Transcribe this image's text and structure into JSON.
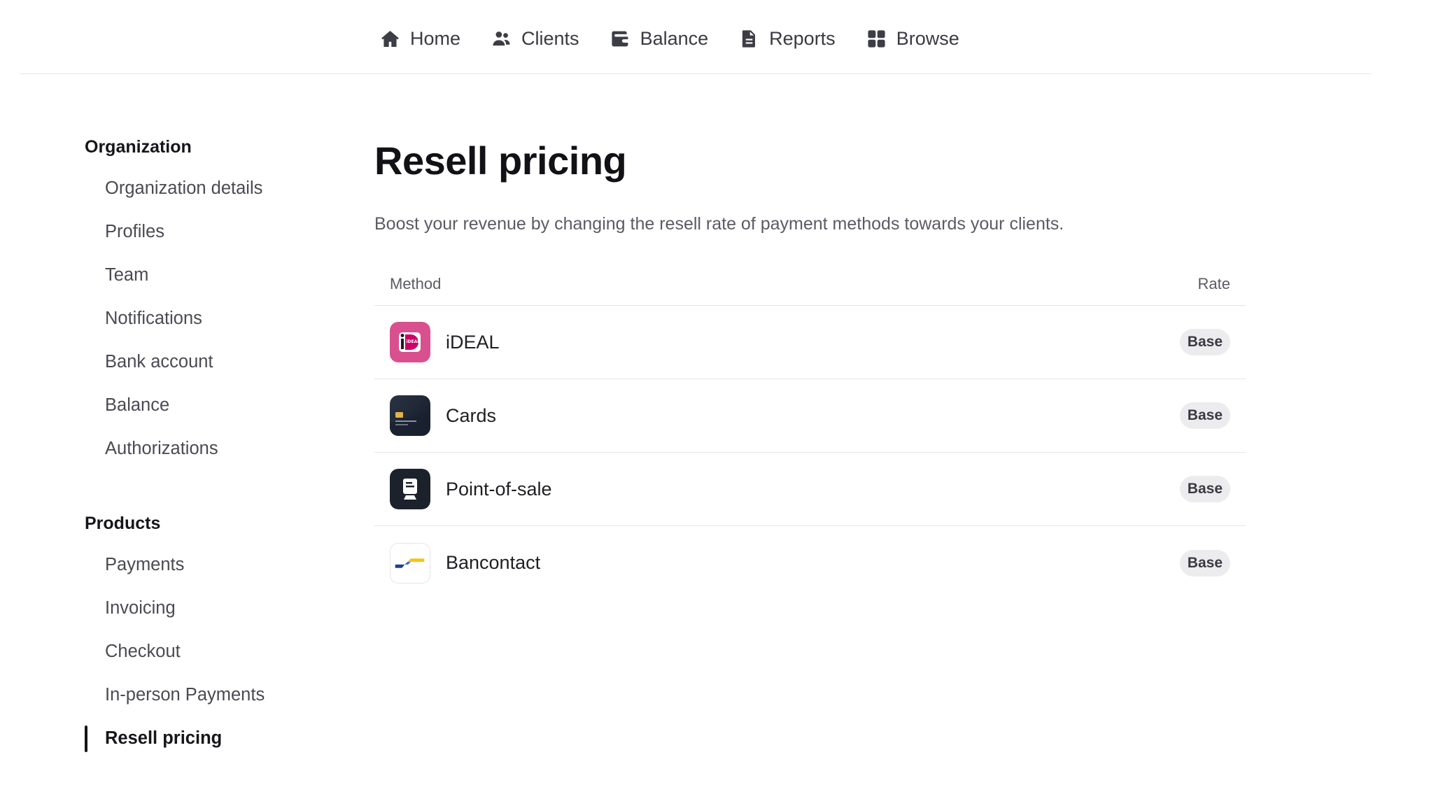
{
  "nav": {
    "items": [
      {
        "label": "Home",
        "icon": "home-icon"
      },
      {
        "label": "Clients",
        "icon": "users-icon"
      },
      {
        "label": "Balance",
        "icon": "wallet-icon"
      },
      {
        "label": "Reports",
        "icon": "document-icon"
      },
      {
        "label": "Browse",
        "icon": "grid-icon"
      }
    ]
  },
  "sidebar": {
    "organization": {
      "heading": "Organization",
      "items": [
        "Organization details",
        "Profiles",
        "Team",
        "Notifications",
        "Bank account",
        "Balance",
        "Authorizations"
      ]
    },
    "products": {
      "heading": "Products",
      "items": [
        "Payments",
        "Invoicing",
        "Checkout",
        "In-person Payments",
        "Resell pricing"
      ],
      "active": "Resell pricing"
    }
  },
  "main": {
    "title": "Resell pricing",
    "description": "Boost your revenue by changing the resell rate of payment methods towards your clients.",
    "table": {
      "columns": {
        "method": "Method",
        "rate": "Rate"
      },
      "rows": [
        {
          "method": "iDEAL",
          "icon": "ideal-icon",
          "rate": "Base"
        },
        {
          "method": "Cards",
          "icon": "credit-card-icon",
          "rate": "Base"
        },
        {
          "method": "Point-of-sale",
          "icon": "pos-terminal-icon",
          "rate": "Base"
        },
        {
          "method": "Bancontact",
          "icon": "bancontact-icon",
          "rate": "Base"
        }
      ]
    }
  },
  "colors": {
    "ideal": "#d9508f",
    "cards": "#1f2633",
    "pos": "#1c222c",
    "bancontact_blue": "#1e3f8f",
    "bancontact_yellow": "#f5c518",
    "badge_bg": "#ececef"
  }
}
